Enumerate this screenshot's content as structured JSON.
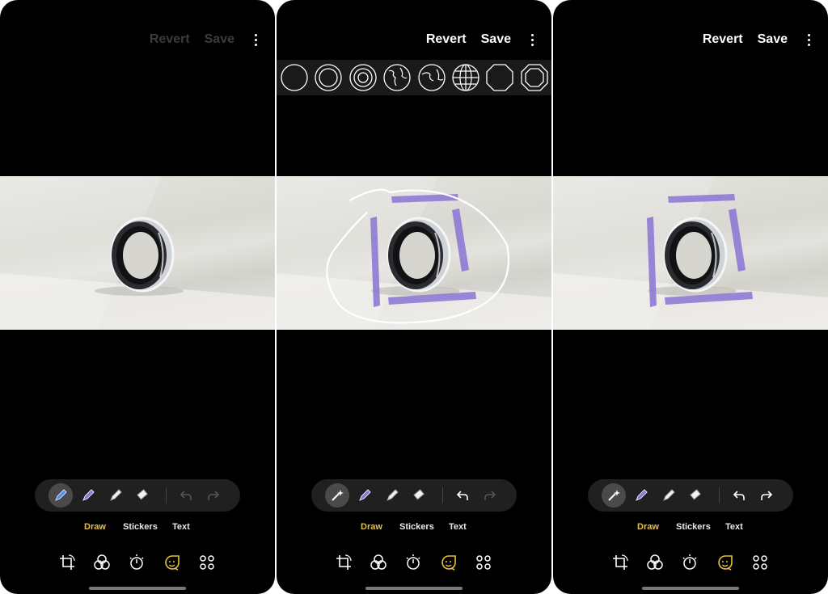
{
  "panels": [
    {
      "id": "before",
      "header": {
        "revert_label": "Revert",
        "save_label": "Save",
        "actions_enabled": false
      },
      "active_tool": "pen",
      "undo_enabled": false,
      "redo_enabled": false,
      "tabs": [
        {
          "label": "Draw",
          "active": true
        },
        {
          "label": "Stickers",
          "active": false
        },
        {
          "label": "Text",
          "active": false
        }
      ],
      "annotations": []
    },
    {
      "id": "drawing",
      "header": {
        "revert_label": "Revert",
        "save_label": "Save",
        "actions_enabled": true
      },
      "active_tool": "shape-magic",
      "shape_picker": [
        "circle",
        "double-circle",
        "triple-circle",
        "globe-1",
        "globe-2",
        "grid-globe",
        "octagon",
        "double-octagon"
      ],
      "undo_enabled": true,
      "redo_enabled": false,
      "tabs": [
        {
          "label": "Draw",
          "active": true
        },
        {
          "label": "Stickers",
          "active": false
        },
        {
          "label": "Text",
          "active": false
        }
      ],
      "annotations": [
        "freehand-white-circle",
        "purple-highlighter-brackets"
      ]
    },
    {
      "id": "after",
      "header": {
        "revert_label": "Revert",
        "save_label": "Save",
        "actions_enabled": true
      },
      "active_tool": "shape-magic",
      "undo_enabled": true,
      "redo_enabled": true,
      "tabs": [
        {
          "label": "Draw",
          "active": true
        },
        {
          "label": "Stickers",
          "active": false
        },
        {
          "label": "Text",
          "active": false
        }
      ],
      "annotations": [
        "purple-highlighter-brackets"
      ]
    }
  ],
  "tools": [
    "pen-icon",
    "highlighter-icon",
    "marker-icon",
    "eraser-icon"
  ],
  "bottom_nav": [
    "crop-rotate-icon",
    "filters-icon",
    "adjust-icon",
    "decorations-icon",
    "more-tools-icon"
  ],
  "colors": {
    "background": "#000000",
    "accent": "#e9c13a",
    "pen_blue": "#4a8cf0",
    "highlighter_purple": "#8b74d4",
    "dim_text": "#3c3c3c"
  }
}
